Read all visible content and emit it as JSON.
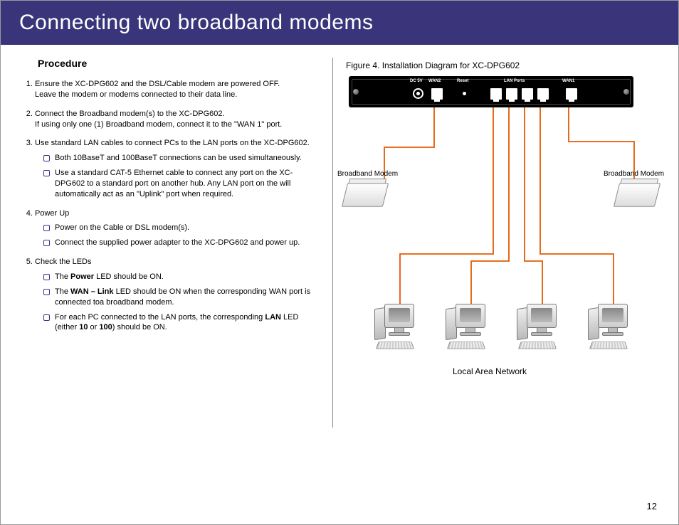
{
  "banner": {
    "title": "Connecting two broadband modems"
  },
  "procedure": {
    "heading": "Procedure",
    "steps": [
      {
        "text": "Ensure the XC-DPG602 and the DSL/Cable modem are powered OFF.",
        "text2": "Leave the modem or modems connected to their data line.",
        "bullets": []
      },
      {
        "text": "Connect the Broadband modem(s) to the XC-DPG602.",
        "text2": "If using only one (1) Broadband modem, connect it to the \"WAN 1\" port.",
        "bullets": []
      },
      {
        "text": "Use standard LAN cables to connect PCs to the LAN ports on the XC-DPG602.",
        "bullets": [
          {
            "html": "Both 10BaseT and 100BaseT connections can be used simultaneously."
          },
          {
            "html": "Use a standard CAT-5 Ethernet cable to connect any port on the XC-DPG602 to a standard port on another hub. Any LAN port on the  will automatically act as an \"Uplink\" port when required."
          }
        ]
      },
      {
        "text": "Power Up",
        "bullets": [
          {
            "html": "Power on the Cable or DSL modem(s)."
          },
          {
            "html": "Connect the supplied power adapter to the XC-DPG602 and power up."
          }
        ]
      },
      {
        "text": "Check the LEDs",
        "bullets": [
          {
            "html": "The <b>Power</b> LED should be ON."
          },
          {
            "html": "The <b>WAN – Link</b> LED should be ON when the corresponding WAN port is connected toa broadband modem."
          },
          {
            "html": "For each PC connected to the LAN ports, the corresponding <b>LAN</b> LED (either <b>10</b> or <b>100</b>) should be ON."
          }
        ]
      }
    ]
  },
  "figure": {
    "caption": "Figure 4.  Installation Diagram for XC-DPG602",
    "ports": {
      "dc": "DC 5V",
      "wan2": "WAN2",
      "reset": "Reset",
      "lan": "LAN Ports",
      "wan1": "WAN1"
    },
    "modem_left": "Broadband Modem",
    "modem_right": "Broadband Modem",
    "lan_label": "Local Area Network"
  },
  "page_number": "12"
}
